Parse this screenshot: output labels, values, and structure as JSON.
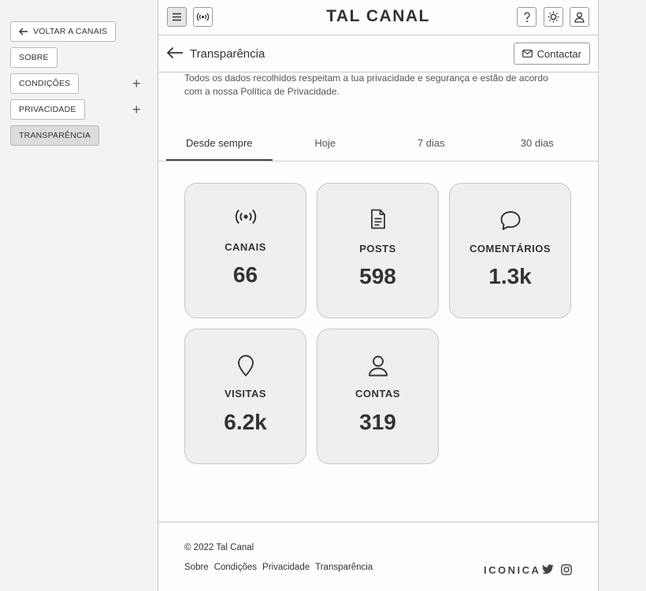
{
  "sidebar": {
    "back_label": "VOLTAR A CANAIS",
    "items": [
      {
        "label": "SOBRE"
      },
      {
        "label": "CONDIÇÕES",
        "expand": "+"
      },
      {
        "label": "PRIVACIDADE",
        "expand": "+"
      },
      {
        "label": "TRANSPARÊNCIA",
        "active": true
      }
    ]
  },
  "header": {
    "title": "TAL CANAL"
  },
  "subheader": {
    "title": "Transparência",
    "contact_label": "Contactar"
  },
  "description": "Todos os dados recolhidos respeitam a tua privacidade e segurança e estão de acordo com a nossa Política de Privacidade.",
  "tabs": [
    {
      "label": "Desde sempre",
      "active": true
    },
    {
      "label": "Hoje"
    },
    {
      "label": "7 dias"
    },
    {
      "label": "30 dias"
    }
  ],
  "stats": [
    {
      "icon": "broadcast-icon",
      "label": "CANAIS",
      "value": "66"
    },
    {
      "icon": "document-icon",
      "label": "POSTS",
      "value": "598"
    },
    {
      "icon": "comment-icon",
      "label": "COMENTÁRIOS",
      "value": "1.3k"
    },
    {
      "icon": "location-pin-icon",
      "label": "VISITAS",
      "value": "6.2k"
    },
    {
      "icon": "user-icon",
      "label": "CONTAS",
      "value": "319"
    }
  ],
  "footer": {
    "copyright": "© 2022 Tal Canal",
    "links": [
      "Sobre",
      "Condições",
      "Privacidade",
      "Transparência"
    ],
    "brand": "ICONICA"
  },
  "colors": {
    "background": "#f3f3f3",
    "panel": "#fdfdfd",
    "card": "#efefef",
    "text": "#333333"
  }
}
